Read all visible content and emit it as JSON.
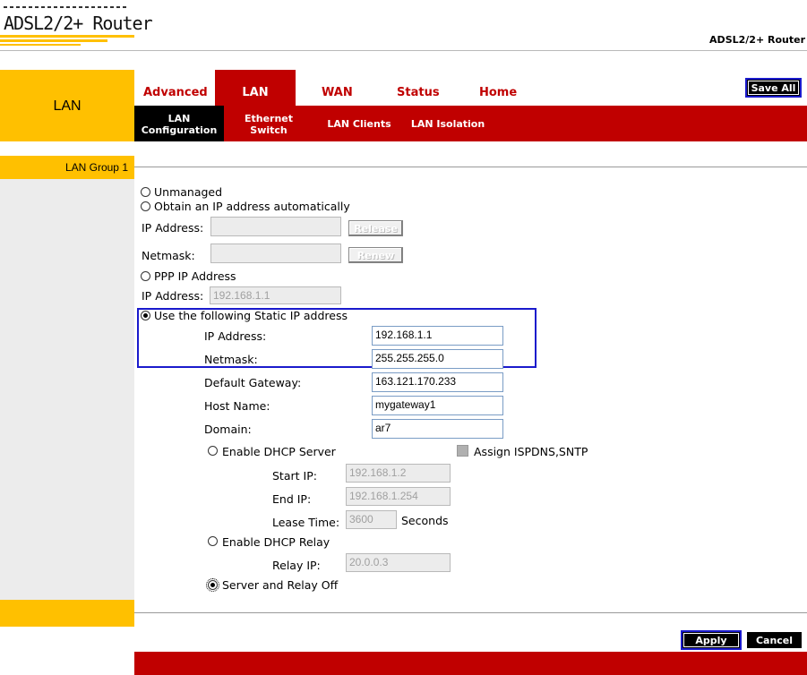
{
  "header": {
    "logo_text": "ADSL2/2+ Router",
    "model_label": "ADSL2/2+ Router"
  },
  "sidebar": {
    "section_title": "LAN",
    "group_label": "LAN Group 1"
  },
  "top_tabs": [
    "Advanced",
    "LAN",
    "WAN",
    "Status",
    "Home"
  ],
  "active_tab": "LAN",
  "save_all_label": "Save All",
  "sub_tabs": [
    {
      "line1": "LAN",
      "line2": "Configuration"
    },
    {
      "line1": "Ethernet",
      "line2": "Switch"
    },
    {
      "line1": "LAN Clients",
      "line2": ""
    },
    {
      "line1": "LAN Isolation",
      "line2": ""
    }
  ],
  "form": {
    "unmanaged_label": "Unmanaged",
    "auto_ip_label": "Obtain an IP address automatically",
    "auto_ip_address_label": "IP Address:",
    "auto_netmask_label": "Netmask:",
    "release_label": "Release",
    "renew_label": "Renew",
    "ppp_label": "PPP IP Address",
    "ppp_ip_label": "IP Address:",
    "ppp_ip_value": "192.168.1.1",
    "static_label": "Use the following Static IP address",
    "static_selected": true,
    "ip_label": "IP Address:",
    "ip_value": "192.168.1.1",
    "netmask_label": "Netmask:",
    "netmask_value": "255.255.255.0",
    "gateway_label": "Default Gateway:",
    "gateway_value": "163.121.170.233",
    "hostname_label": "Host Name:",
    "hostname_value": "mygateway1",
    "domain_label": "Domain:",
    "domain_value": "ar7",
    "dhcp_server_label": "Enable DHCP Server",
    "assign_label": "Assign ISPDNS,SNTP",
    "start_ip_label": "Start IP:",
    "start_ip_value": "192.168.1.2",
    "end_ip_label": "End IP:",
    "end_ip_value": "192.168.1.254",
    "lease_label": "Lease Time:",
    "lease_value": "3600",
    "seconds_label": "Seconds",
    "dhcp_relay_label": "Enable DHCP Relay",
    "relay_ip_label": "Relay IP:",
    "relay_ip_value": "20.0.0.3",
    "server_relay_off_label": "Server and Relay Off"
  },
  "actions": {
    "apply_label": "Apply",
    "cancel_label": "Cancel"
  },
  "colors": {
    "brand_red": "#c00000",
    "brand_yellow": "#ffc000",
    "highlight_blue": "#1a1acc"
  }
}
